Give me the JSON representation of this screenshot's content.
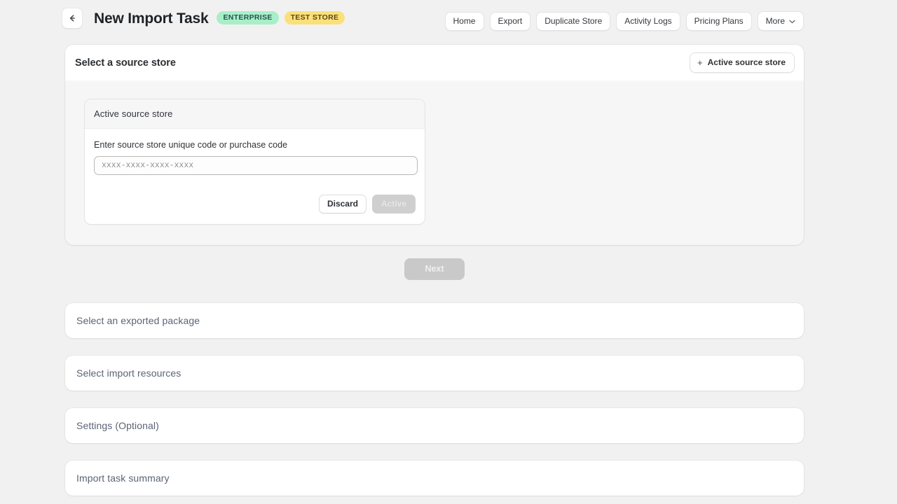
{
  "header": {
    "back_icon": "arrow-left-icon",
    "title": "New Import Task",
    "badges": [
      {
        "label": "ENTERPRISE",
        "bg": "#a8efc9",
        "fg": "#24544b"
      },
      {
        "label": "TEST STORE",
        "bg": "#fbe07a",
        "fg": "#5e4717"
      }
    ],
    "nav": [
      {
        "label": "Home",
        "has_chevron": false
      },
      {
        "label": "Export",
        "has_chevron": false
      },
      {
        "label": "Duplicate Store",
        "has_chevron": false
      },
      {
        "label": "Activity Logs",
        "has_chevron": false
      },
      {
        "label": "Pricing Plans",
        "has_chevron": false
      },
      {
        "label": "More",
        "has_chevron": true
      }
    ]
  },
  "step": {
    "title": "Select a source store",
    "action_button": {
      "icon": "plus-icon",
      "label": "Active source store"
    },
    "form": {
      "card_title": "Active source store",
      "field_label": "Enter source store unique code or purchase code",
      "input_value": "",
      "input_placeholder": "xxxx-xxxx-xxxx-xxxx",
      "discard_label": "Discard",
      "active_label": "Active"
    },
    "next_label": "Next"
  },
  "sections": [
    {
      "title": "Select an exported package"
    },
    {
      "title": "Select import resources"
    },
    {
      "title": "Settings (Optional)"
    },
    {
      "title": "Import task summary"
    }
  ],
  "colors": {
    "page_bg": "#f1f1f1",
    "card_bg": "#ffffff",
    "muted_panel": "#f6f6f7",
    "section_title": "#5a6474",
    "disabled_btn_bg": "#c9c9c9"
  }
}
